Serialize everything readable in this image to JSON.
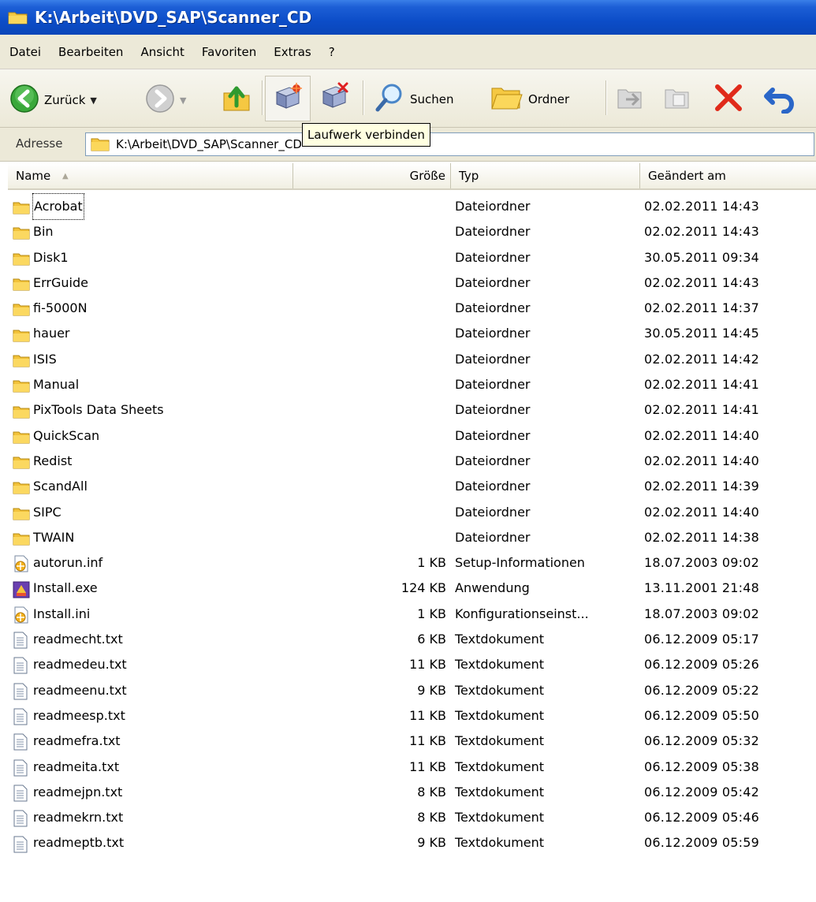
{
  "window": {
    "title": "K:\\Arbeit\\DVD_SAP\\Scanner_CD"
  },
  "menu": [
    "Datei",
    "Bearbeiten",
    "Ansicht",
    "Favoriten",
    "Extras",
    "?"
  ],
  "toolbar": {
    "back_label": "Zurück",
    "search_label": "Suchen",
    "folders_label": "Ordner",
    "tooltip": "Laufwerk verbinden"
  },
  "address": {
    "label": "Adresse",
    "path": "K:\\Arbeit\\DVD_SAP\\Scanner_CD"
  },
  "columns": {
    "name": "Name",
    "size": "Größe",
    "type": "Typ",
    "modified": "Geändert am"
  },
  "files": [
    {
      "name": "Acrobat",
      "size": "",
      "type": "Dateiordner",
      "date": "02.02.2011 14:43",
      "icon": "folder-icon"
    },
    {
      "name": "Bin",
      "size": "",
      "type": "Dateiordner",
      "date": "02.02.2011 14:43",
      "icon": "folder-icon"
    },
    {
      "name": "Disk1",
      "size": "",
      "type": "Dateiordner",
      "date": "30.05.2011 09:34",
      "icon": "folder-icon"
    },
    {
      "name": "ErrGuide",
      "size": "",
      "type": "Dateiordner",
      "date": "02.02.2011 14:43",
      "icon": "folder-icon"
    },
    {
      "name": "fi-5000N",
      "size": "",
      "type": "Dateiordner",
      "date": "02.02.2011 14:37",
      "icon": "folder-icon"
    },
    {
      "name": "hauer",
      "size": "",
      "type": "Dateiordner",
      "date": "30.05.2011 14:45",
      "icon": "folder-icon"
    },
    {
      "name": "ISIS",
      "size": "",
      "type": "Dateiordner",
      "date": "02.02.2011 14:42",
      "icon": "folder-icon"
    },
    {
      "name": "Manual",
      "size": "",
      "type": "Dateiordner",
      "date": "02.02.2011 14:41",
      "icon": "folder-icon"
    },
    {
      "name": "PixTools Data Sheets",
      "size": "",
      "type": "Dateiordner",
      "date": "02.02.2011 14:41",
      "icon": "folder-icon"
    },
    {
      "name": "QuickScan",
      "size": "",
      "type": "Dateiordner",
      "date": "02.02.2011 14:40",
      "icon": "folder-icon"
    },
    {
      "name": "Redist",
      "size": "",
      "type": "Dateiordner",
      "date": "02.02.2011 14:40",
      "icon": "folder-icon"
    },
    {
      "name": "ScandAll",
      "size": "",
      "type": "Dateiordner",
      "date": "02.02.2011 14:39",
      "icon": "folder-icon"
    },
    {
      "name": "SIPC",
      "size": "",
      "type": "Dateiordner",
      "date": "02.02.2011 14:40",
      "icon": "folder-icon"
    },
    {
      "name": "TWAIN",
      "size": "",
      "type": "Dateiordner",
      "date": "02.02.2011 14:38",
      "icon": "folder-icon"
    },
    {
      "name": "autorun.inf",
      "size": "1 KB",
      "type": "Setup-Informationen",
      "date": "18.07.2003 09:02",
      "icon": "setup-file-icon"
    },
    {
      "name": "Install.exe",
      "size": "124 KB",
      "type": "Anwendung",
      "date": "13.11.2001 21:48",
      "icon": "application-icon"
    },
    {
      "name": "Install.ini",
      "size": "1 KB",
      "type": "Konfigurationseinst...",
      "date": "18.07.2003 09:02",
      "icon": "setup-file-icon"
    },
    {
      "name": "readmecht.txt",
      "size": "6 KB",
      "type": "Textdokument",
      "date": "06.12.2009 05:17",
      "icon": "text-file-icon"
    },
    {
      "name": "readmedeu.txt",
      "size": "11 KB",
      "type": "Textdokument",
      "date": "06.12.2009 05:26",
      "icon": "text-file-icon"
    },
    {
      "name": "readmeenu.txt",
      "size": "9 KB",
      "type": "Textdokument",
      "date": "06.12.2009 05:22",
      "icon": "text-file-icon"
    },
    {
      "name": "readmeesp.txt",
      "size": "11 KB",
      "type": "Textdokument",
      "date": "06.12.2009 05:50",
      "icon": "text-file-icon"
    },
    {
      "name": "readmefra.txt",
      "size": "11 KB",
      "type": "Textdokument",
      "date": "06.12.2009 05:32",
      "icon": "text-file-icon"
    },
    {
      "name": "readmeita.txt",
      "size": "11 KB",
      "type": "Textdokument",
      "date": "06.12.2009 05:38",
      "icon": "text-file-icon"
    },
    {
      "name": "readmejpn.txt",
      "size": "8 KB",
      "type": "Textdokument",
      "date": "06.12.2009 05:42",
      "icon": "text-file-icon"
    },
    {
      "name": "readmekrn.txt",
      "size": "8 KB",
      "type": "Textdokument",
      "date": "06.12.2009 05:46",
      "icon": "text-file-icon"
    },
    {
      "name": "readmeptb.txt",
      "size": "9 KB",
      "type": "Textdokument",
      "date": "06.12.2009 05:59",
      "icon": "text-file-icon"
    }
  ]
}
